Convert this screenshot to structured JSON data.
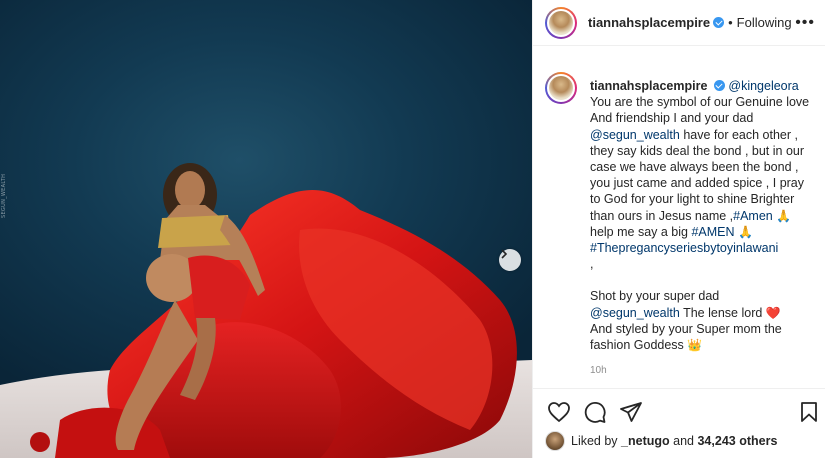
{
  "post": {
    "username": "tiannahsplacempire",
    "follow_label": "Following",
    "separator": "•",
    "more_label": "•••",
    "photo_watermark": "SEGUN_WEALTH"
  },
  "caption": {
    "username": "tiannahsplacempire",
    "mention_1": "@kingeleora",
    "text_1": " You are the symbol of our Genuine love And friendship I and your dad ",
    "mention_2": "@segun_wealth",
    "text_2": " have for each other , they say kids deal the bond , but in our case we have always been the bond , you just came and added spice , I pray to God for your light to shine Brighter than ours in Jesus name ,",
    "hashtag_1": "#Amen",
    "emoji_pray": "🙏",
    "text_3": " help me say a big ",
    "hashtag_2": "#AMEN",
    "hashtag_3": "#Thepregancyseriesbytoyinlawani",
    "text_4": ",",
    "shot_by": "Shot by your super dad",
    "mention_3": "@segun_wealth",
    "text_5": " The lense lord ",
    "emoji_heart": "❤️",
    "styled_by": "And styled by your Super mom the fashion Goddess ",
    "emoji_crown": "👑",
    "timestamp": "10h"
  },
  "likes": {
    "prefix": "Liked by",
    "user": "_netugo",
    "joiner": "and",
    "count_text": "34,243 others"
  },
  "icons": {
    "like": "heart-icon",
    "comment": "comment-icon",
    "share": "paper-plane-icon",
    "save": "bookmark-icon",
    "next": "chevron-right-icon"
  },
  "colors": {
    "link": "#00376b",
    "verified": "#3897f0",
    "gown": "#d91a1a"
  }
}
